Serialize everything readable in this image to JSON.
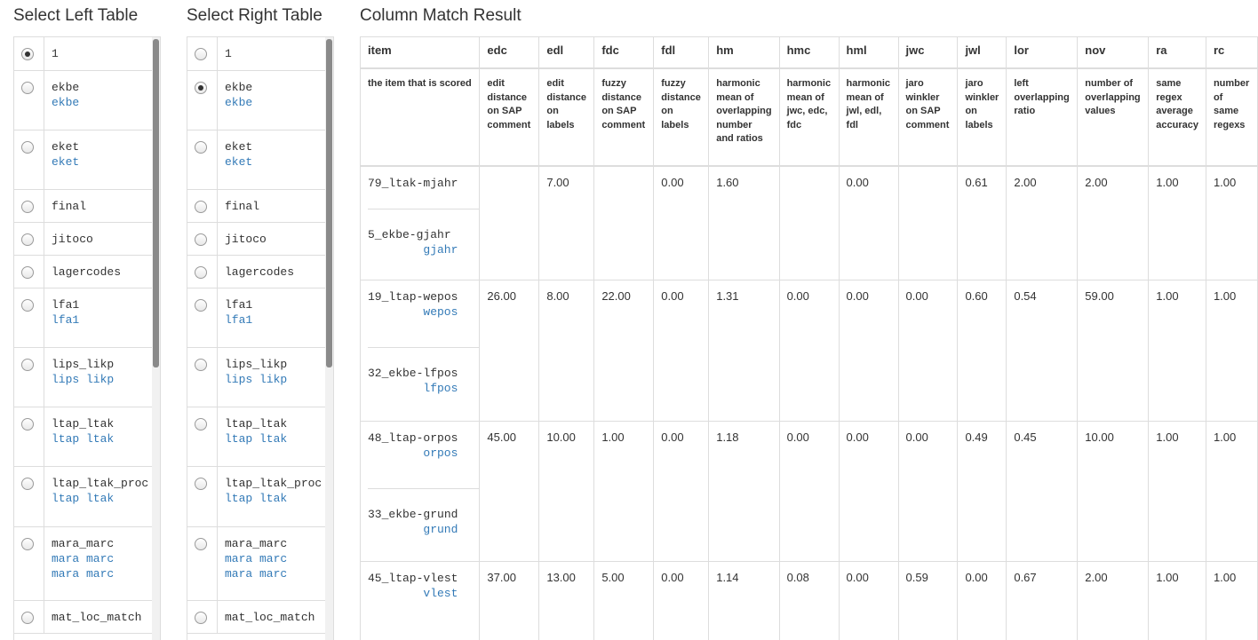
{
  "left": {
    "heading": "Select Left Table",
    "items": [
      {
        "name": "1",
        "sub": [],
        "selected": true,
        "h": 38
      },
      {
        "name": "ekbe",
        "sub": [
          "ekbe"
        ],
        "selected": false,
        "h": 67
      },
      {
        "name": "eket",
        "sub": [
          "eket"
        ],
        "selected": false,
        "h": 67
      },
      {
        "name": "final",
        "sub": [],
        "selected": false,
        "h": 37
      },
      {
        "name": "jitoco",
        "sub": [],
        "selected": false,
        "h": 37
      },
      {
        "name": "lagercodes",
        "sub": [],
        "selected": false,
        "h": 37
      },
      {
        "name": "lfa1",
        "sub": [
          "lfa1"
        ],
        "selected": false,
        "h": 67
      },
      {
        "name": "lips_likp",
        "sub": [
          "lips likp"
        ],
        "selected": false,
        "h": 67
      },
      {
        "name": "ltap_ltak",
        "sub": [
          "ltap ltak"
        ],
        "selected": false,
        "h": 67
      },
      {
        "name": "ltap_ltak_proc",
        "sub": [
          "ltap ltak"
        ],
        "selected": false,
        "h": 68
      },
      {
        "name": "mara_marc",
        "sub": [
          "mara marc",
          "mara marc"
        ],
        "selected": false,
        "h": 83
      },
      {
        "name": "mat_loc_match",
        "sub": [],
        "selected": false,
        "h": 37
      }
    ]
  },
  "right": {
    "heading": "Select Right Table",
    "items": [
      {
        "name": "1",
        "sub": [],
        "selected": false,
        "h": 38
      },
      {
        "name": "ekbe",
        "sub": [
          "ekbe"
        ],
        "selected": true,
        "h": 67
      },
      {
        "name": "eket",
        "sub": [
          "eket"
        ],
        "selected": false,
        "h": 67
      },
      {
        "name": "final",
        "sub": [],
        "selected": false,
        "h": 37
      },
      {
        "name": "jitoco",
        "sub": [],
        "selected": false,
        "h": 37
      },
      {
        "name": "lagercodes",
        "sub": [],
        "selected": false,
        "h": 37
      },
      {
        "name": "lfa1",
        "sub": [
          "lfa1"
        ],
        "selected": false,
        "h": 67
      },
      {
        "name": "lips_likp",
        "sub": [
          "lips likp"
        ],
        "selected": false,
        "h": 67
      },
      {
        "name": "ltap_ltak",
        "sub": [
          "ltap ltak"
        ],
        "selected": false,
        "h": 67
      },
      {
        "name": "ltap_ltak_proc",
        "sub": [
          "ltap ltak"
        ],
        "selected": false,
        "h": 68
      },
      {
        "name": "mara_marc",
        "sub": [
          "mara marc",
          "mara marc"
        ],
        "selected": false,
        "h": 83
      },
      {
        "name": "mat_loc_match",
        "sub": [],
        "selected": false,
        "h": 37
      }
    ]
  },
  "result": {
    "heading": "Column Match Result",
    "columns": [
      {
        "key": "item",
        "desc": "the item that is scored"
      },
      {
        "key": "edc",
        "desc": "edit distance on SAP comment"
      },
      {
        "key": "edl",
        "desc": "edit distance on labels"
      },
      {
        "key": "fdc",
        "desc": "fuzzy distance on SAP comment"
      },
      {
        "key": "fdl",
        "desc": "fuzzy distance on labels"
      },
      {
        "key": "hm",
        "desc": "harmonic mean of overlapping number and ratios"
      },
      {
        "key": "hmc",
        "desc": "harmonic mean of jwc, edc, fdc"
      },
      {
        "key": "hml",
        "desc": "harmonic mean of jwl, edl, fdl"
      },
      {
        "key": "jwc",
        "desc": "jaro winkler on SAP comment"
      },
      {
        "key": "jwl",
        "desc": "jaro winkler on labels"
      },
      {
        "key": "lor",
        "desc": "left overlapping ratio"
      },
      {
        "key": "nov",
        "desc": "number of overlapping values"
      },
      {
        "key": "ra",
        "desc": "same regex average accuracy"
      },
      {
        "key": "rc",
        "desc": "number of same regexs"
      }
    ],
    "rows": [
      {
        "left": {
          "name": "79_ltak-mjahr",
          "sub": ""
        },
        "right": {
          "name": "5_ekbe-gjahr",
          "sub": "gjahr"
        },
        "values": [
          "",
          "7.00",
          "",
          "0.00",
          "1.60",
          "",
          "0.00",
          "",
          "0.61",
          "2.00",
          "2.00",
          "1.00",
          "1.00"
        ]
      },
      {
        "left": {
          "name": "19_ltap-wepos",
          "sub": "wepos"
        },
        "right": {
          "name": "32_ekbe-lfpos",
          "sub": "lfpos"
        },
        "values": [
          "26.00",
          "8.00",
          "22.00",
          "0.00",
          "1.31",
          "0.00",
          "0.00",
          "0.00",
          "0.60",
          "0.54",
          "59.00",
          "1.00",
          "1.00"
        ]
      },
      {
        "left": {
          "name": "48_ltap-orpos",
          "sub": "orpos"
        },
        "right": {
          "name": "33_ekbe-grund",
          "sub": "grund"
        },
        "values": [
          "45.00",
          "10.00",
          "1.00",
          "0.00",
          "1.18",
          "0.00",
          "0.00",
          "0.00",
          "0.49",
          "0.45",
          "10.00",
          "1.00",
          "1.00"
        ]
      },
      {
        "left": {
          "name": "45_ltap-vlest",
          "sub": "vlest"
        },
        "right": {
          "name": "",
          "sub": ""
        },
        "values": [
          "37.00",
          "13.00",
          "5.00",
          "0.00",
          "1.14",
          "0.08",
          "0.00",
          "0.59",
          "0.00",
          "0.67",
          "2.00",
          "1.00",
          "1.00"
        ]
      }
    ]
  }
}
